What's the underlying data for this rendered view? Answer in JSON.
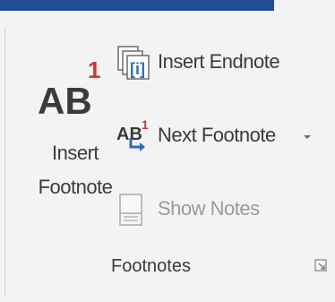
{
  "group": {
    "label": "Footnotes"
  },
  "insert_footnote": {
    "icon_text": "AB",
    "icon_superscript": "1",
    "label_line1": "Insert",
    "label_line2": "Footnote",
    "icon": "insert-footnote-icon"
  },
  "insert_endnote": {
    "label": "Insert Endnote",
    "icon": "insert-endnote-icon"
  },
  "next_footnote": {
    "label": "Next Footnote",
    "icon_text": "AB",
    "icon_superscript": "1",
    "icon": "next-footnote-icon",
    "dropdown_icon": "chevron-down-icon"
  },
  "show_notes": {
    "label": "Show Notes",
    "icon": "show-notes-icon",
    "enabled": false
  },
  "colors": {
    "accent_bar": "#1f4e96",
    "superscript_red": "#d13438",
    "text": "#3b3b3b",
    "disabled_text": "#9a9a9a",
    "arrow_blue": "#2b6cc4"
  }
}
